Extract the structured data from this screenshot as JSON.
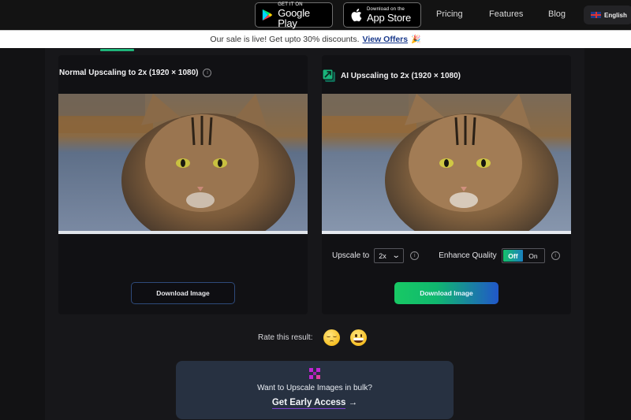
{
  "nav": {
    "google_play": {
      "small": "GET IT ON",
      "big": "Google Play"
    },
    "app_store": {
      "small": "Download on the",
      "big": "App Store"
    },
    "links": [
      "Pricing",
      "Features",
      "Blog"
    ],
    "language": "English"
  },
  "banner": {
    "text": "Our sale is live! Get upto 30% discounts.",
    "link": "View Offers",
    "emoji": "🎉"
  },
  "panels": {
    "normal": {
      "title": "Normal Upscaling to 2x (1920 × 1080)",
      "download_label": "Download Image"
    },
    "ai": {
      "title": "AI Upscaling to 2x (1920 × 1080)",
      "upscale_label": "Upscale to",
      "upscale_value": "2x",
      "enhance_label": "Enhance Quality",
      "toggle_off": "Off",
      "toggle_on": "On",
      "toggle_state": "Off",
      "download_label": "Download Image"
    }
  },
  "rating": {
    "label": "Rate this result:",
    "options": [
      "pensive-face",
      "grinning-face"
    ]
  },
  "bulk": {
    "text": "Want to Upscale Images in bulk?",
    "cta": "Get Early Access",
    "arrow": "→"
  },
  "colors": {
    "accent_green": "#1fb67a",
    "accent_blue": "#2157c9",
    "bulk_icon": "#c026d3"
  }
}
